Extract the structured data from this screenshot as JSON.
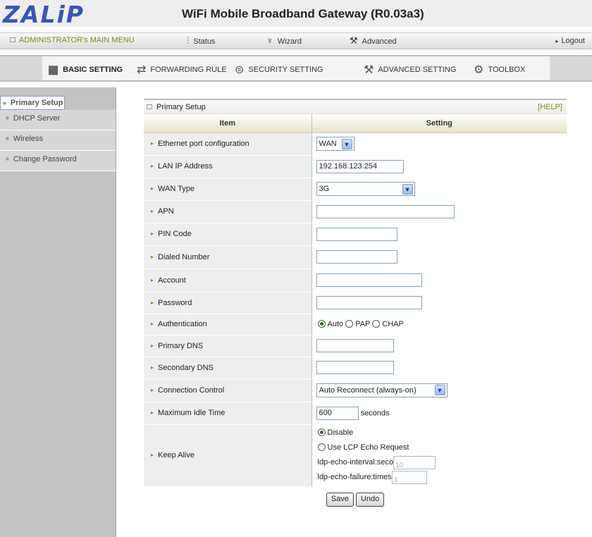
{
  "header": {
    "logo": "ZALiP",
    "title": "WiFi Mobile Broadband Gateway (R0.03a3)"
  },
  "topmenu": {
    "admin": "ADMINISTRATOR's MAIN MENU",
    "status": "Status",
    "wizard": "Wizard",
    "advanced": "Advanced",
    "logout": "Logout"
  },
  "tabs": [
    "BASIC SETTING",
    "FORWARDING RULE",
    "SECURITY SETTING",
    "ADVANCED SETTING",
    "TOOLBOX"
  ],
  "sidebar": [
    "Primary Setup",
    "DHCP Server",
    "Wireless",
    "Change Password"
  ],
  "panel": {
    "title": "Primary Setup",
    "help": "[HELP]",
    "col_item": "Item",
    "col_setting": "Setting"
  },
  "fields": {
    "ethernet_port": {
      "label": "Ethernet port configuration",
      "value": "WAN"
    },
    "lan_ip": {
      "label": "LAN IP Address",
      "value": "192.168.123.254"
    },
    "wan_type": {
      "label": "WAN Type",
      "value": "3G"
    },
    "apn": {
      "label": "APN",
      "value": ""
    },
    "pin": {
      "label": "PIN Code",
      "value": ""
    },
    "dialed": {
      "label": "Dialed Number",
      "value": ""
    },
    "account": {
      "label": "Account",
      "value": ""
    },
    "password": {
      "label": "Password",
      "value": ""
    },
    "auth": {
      "label": "Authentication",
      "opt1": "Auto",
      "opt2": "PAP",
      "opt3": "CHAP"
    },
    "pdns": {
      "label": "Primary DNS",
      "value": ""
    },
    "sdns": {
      "label": "Secondary DNS",
      "value": ""
    },
    "conn": {
      "label": "Connection Control",
      "value": "Auto Reconnect (always-on)"
    },
    "idle": {
      "label": "Maximum Idle Time",
      "value": "600",
      "unit": "seconds"
    },
    "keepalive": {
      "label": "Keep Alive",
      "disable": "Disable",
      "lcp": "Use LCP Echo Request",
      "interval_label": "ldp-echo-interval:seco",
      "interval_value": "10",
      "failure_label": "ldp-echo-failure:times",
      "failure_value": "3"
    }
  },
  "buttons": {
    "save": "Save",
    "undo": "Undo"
  },
  "colors": {
    "brand_blue": "#3a55b4",
    "accent_green": "#6f8f22"
  }
}
